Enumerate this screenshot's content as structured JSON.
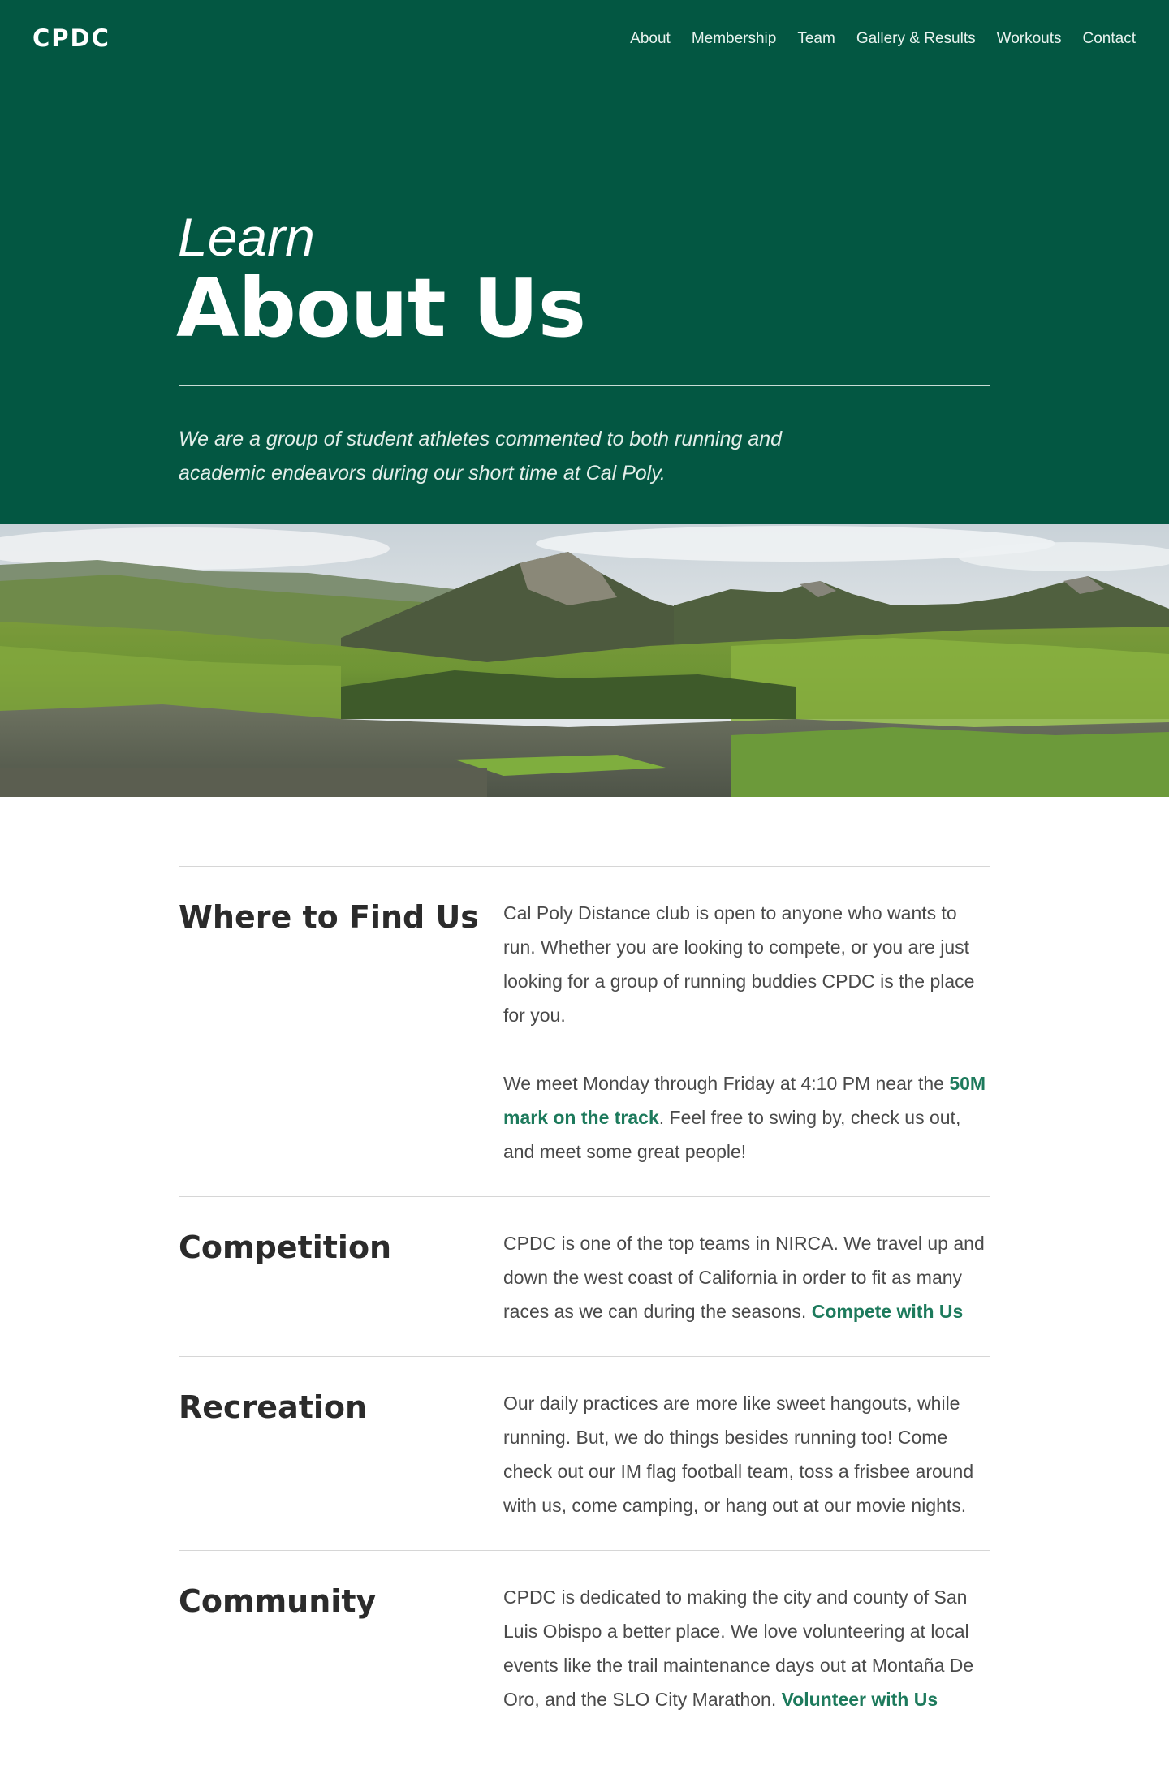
{
  "nav": {
    "logo": "CPDC",
    "items": [
      {
        "label": "About"
      },
      {
        "label": "Membership"
      },
      {
        "label": "Team"
      },
      {
        "label": "Gallery & Results"
      },
      {
        "label": "Workouts"
      },
      {
        "label": "Contact"
      }
    ]
  },
  "hero": {
    "kicker": "Learn",
    "title": "About Us",
    "tagline": "We are a group of student athletes commented to both running and academic endeavors during our short time at Cal Poly."
  },
  "banner": {
    "image": "mountain-landscape-photo"
  },
  "sections": [
    {
      "title": "Where to Find Us",
      "p1": "Cal Poly Distance club is open to anyone who wants to run. Whether you are looking to compete, or you are just looking for a group of running buddies CPDC is the place for you.",
      "p2_before": "We meet Monday through Friday at 4:10 PM near the ",
      "p2_link": "50M mark on the track",
      "p2_after": ". Feel free to swing by, check us out, and meet some great people!"
    },
    {
      "title": "Competition",
      "text": "CPDC is one of the top teams in NIRCA. We travel up and down the west coast of California in order to fit as many races as we can during the seasons. ",
      "link": "Compete with Us"
    },
    {
      "title": "Recreation",
      "text": "Our daily practices are more like sweet hangouts, while running. But, we do things besides running too! Come check out our IM flag football team, toss a frisbee around with us, come camping, or hang out at our movie nights."
    },
    {
      "title": "Community",
      "text": "CPDC is dedicated to making the city and county of San Luis Obispo a better place. We love volunteering at local events like the trail maintenance days out at Montaña De Oro, and the SLO City Marathon. ",
      "link": "Volunteer with Us"
    }
  ],
  "colors": {
    "brand_green": "#035742",
    "link_green": "#1d7a5c"
  }
}
